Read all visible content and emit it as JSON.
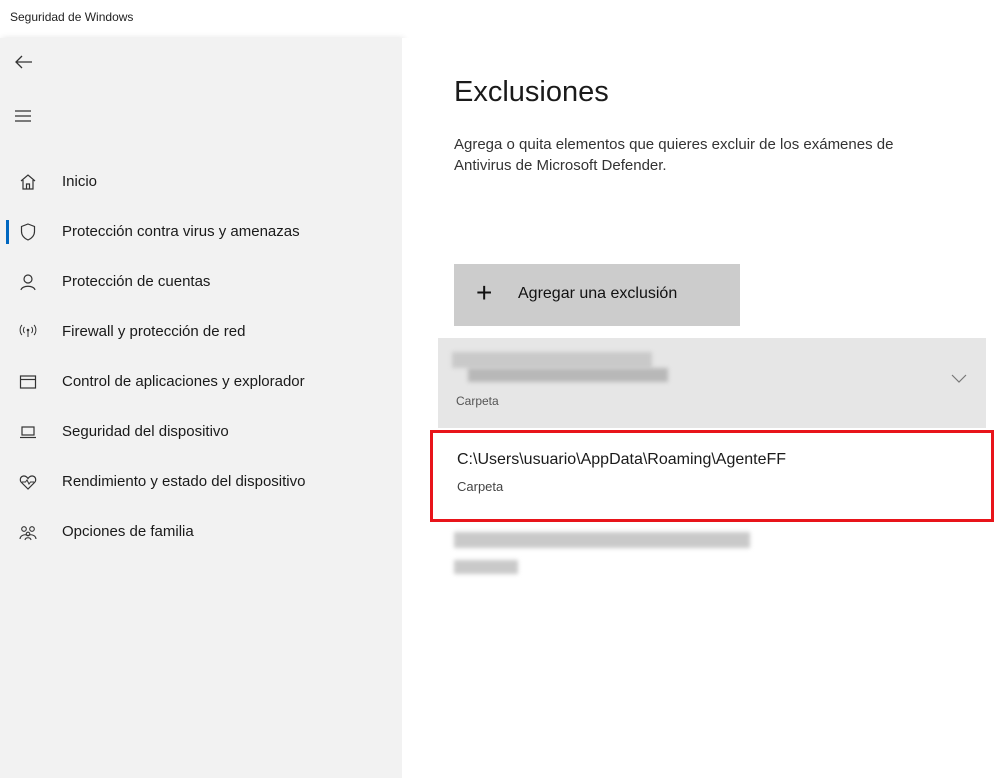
{
  "window": {
    "title": "Seguridad de Windows"
  },
  "sidebar": {
    "back_icon": "back-arrow-icon",
    "menu_icon": "hamburger-icon",
    "items": [
      {
        "label": "Inicio",
        "icon": "home-icon",
        "selected": false
      },
      {
        "label": "Protección contra virus y amenazas",
        "icon": "shield-icon",
        "selected": true
      },
      {
        "label": "Protección de cuentas",
        "icon": "person-icon",
        "selected": false
      },
      {
        "label": "Firewall y protección de red",
        "icon": "wifi-antenna-icon",
        "selected": false
      },
      {
        "label": "Control de aplicaciones y explorador",
        "icon": "app-window-icon",
        "selected": false
      },
      {
        "label": "Seguridad del dispositivo",
        "icon": "laptop-icon",
        "selected": false
      },
      {
        "label": "Rendimiento y estado del dispositivo",
        "icon": "heart-pulse-icon",
        "selected": false
      },
      {
        "label": "Opciones de familia",
        "icon": "family-icon",
        "selected": false
      }
    ],
    "accent_color": "#0067c0"
  },
  "main": {
    "title": "Exclusiones",
    "description_line1": "Agrega o quita elementos que quieres excluir de los exámenes de",
    "description_line2": "Antivirus de Microsoft Defender.",
    "add_button": {
      "icon": "plus-icon",
      "label": "Agregar una exclusión"
    },
    "exclusions": [
      {
        "path": "",
        "type": "Carpeta",
        "expanded": true,
        "redacted": true
      },
      {
        "path": "C:\\Users\\usuario\\AppData\\Roaming\\AgenteFF",
        "type": "Carpeta",
        "highlighted": true
      },
      {
        "path": "",
        "type": "",
        "redacted": true
      }
    ],
    "highlight_color": "#e8141a"
  }
}
